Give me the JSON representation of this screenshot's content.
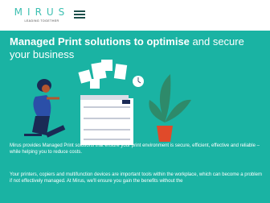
{
  "header": {
    "logo_word": "MIRUS",
    "logo_tagline": "LEADING TOGETHER"
  },
  "hero": {
    "title_bold": "Managed Print solutions to optimise",
    "title_rest": " and secure your business"
  },
  "body": {
    "p1": "Mirus provides Managed Print solutions that ensure your print environment is secure, efficient, effective and reliable – while helping you to reduce costs.",
    "p2": "Your printers, copiers and multifunction devices are important tools within the workplace, which can become a problem if not effectively managed. At Mirus, we'll ensure you gain the benefits without the"
  },
  "colors": {
    "background": "#1ab3a3",
    "accent": "#3cbfb1",
    "dark_navy": "#1a2a55",
    "plant": "#2e8a6a",
    "pot": "#e04a2a"
  },
  "icons": [
    "menu-icon",
    "clock-icon"
  ]
}
